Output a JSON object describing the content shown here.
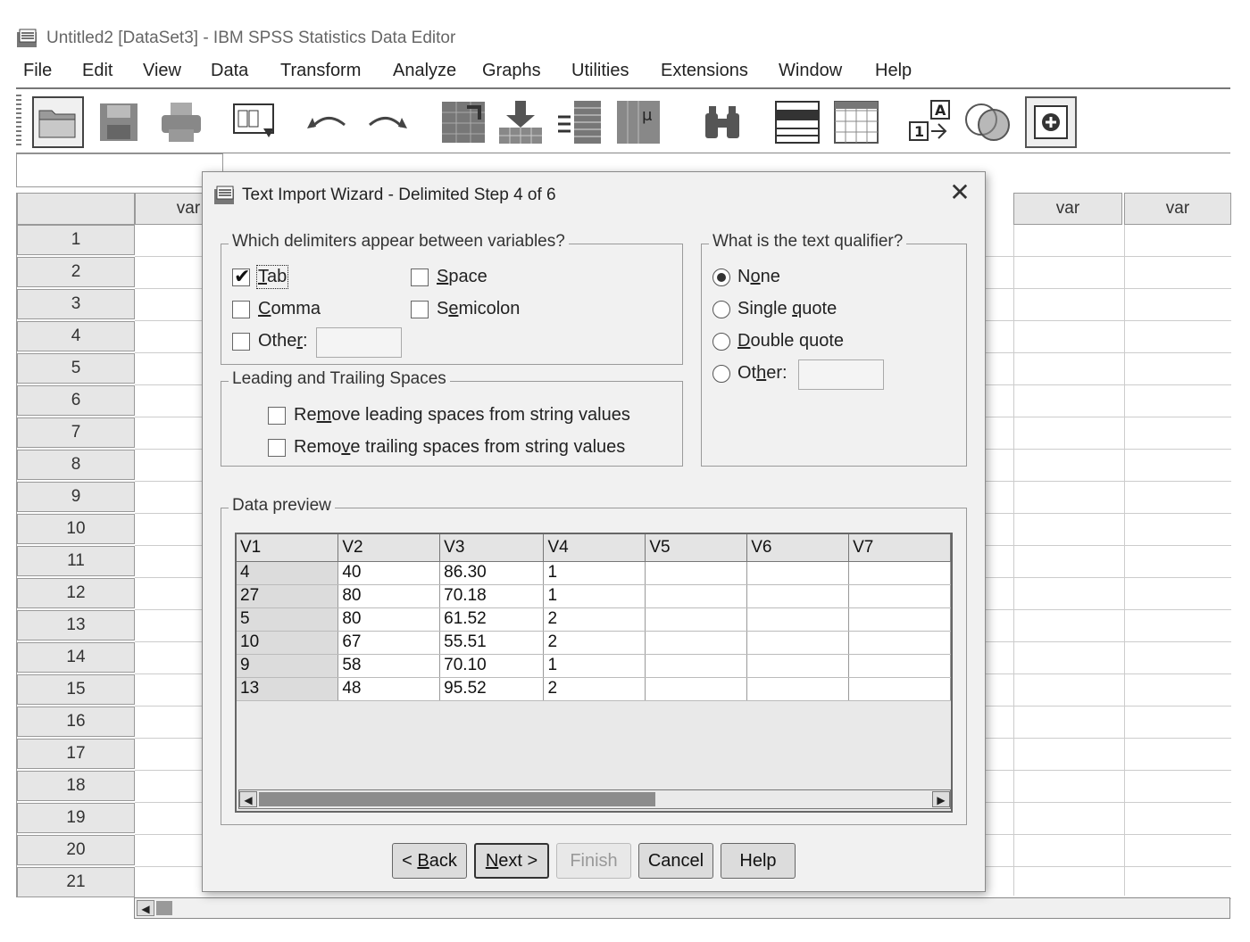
{
  "window": {
    "title": "Untitled2 [DataSet3] - IBM SPSS Statistics Data Editor"
  },
  "menu": [
    "File",
    "Edit",
    "View",
    "Data",
    "Transform",
    "Analyze",
    "Graphs",
    "Utilities",
    "Extensions",
    "Window",
    "Help"
  ],
  "toolbar_icons": [
    "open-folder-icon",
    "save-icon",
    "print-icon",
    "recall-dialog-icon",
    "undo-icon",
    "redo-icon",
    "goto-case-icon",
    "goto-variable-icon",
    "variables-icon",
    "run-descriptive-icon",
    "find-icon",
    "insert-cases-icon",
    "insert-variable-icon",
    "split-file-icon",
    "value-labels-icon",
    "use-sets-icon"
  ],
  "grid": {
    "col_headers": [
      "var",
      "var",
      "var"
    ],
    "rows": [
      "1",
      "2",
      "3",
      "4",
      "5",
      "6",
      "7",
      "8",
      "9",
      "10",
      "11",
      "12",
      "13",
      "14",
      "15",
      "16",
      "17",
      "18",
      "19",
      "20",
      "21"
    ]
  },
  "dialog": {
    "title": "Text Import Wizard - Delimited Step 4 of 6",
    "delimiters_legend": "Which delimiters appear between variables?",
    "delimiters": {
      "tab": "Tab",
      "space": "Space",
      "comma": "Comma",
      "semicolon": "Semicolon",
      "other": "Other:"
    },
    "spaces_legend": "Leading and Trailing Spaces",
    "remove_leading": "Remove leading spaces from string values",
    "remove_trailing": "Remove trailing spaces from string values",
    "qualifier_legend": "What is the text qualifier?",
    "qualifiers": {
      "none": "None",
      "single": "Single quote",
      "double": "Double quote",
      "other": "Other:"
    },
    "preview_legend": "Data preview",
    "preview": {
      "headers": [
        "V1",
        "V2",
        "V3",
        "V4",
        "V5",
        "V6",
        "V7"
      ],
      "rows": [
        [
          "4",
          "40",
          "86.30",
          "1"
        ],
        [
          "27",
          "80",
          "70.18",
          "1"
        ],
        [
          "5",
          "80",
          "61.52",
          "2"
        ],
        [
          "10",
          "67",
          "55.51",
          "2"
        ],
        [
          "9",
          "58",
          "70.10",
          "1"
        ],
        [
          "13",
          "48",
          "95.52",
          "2"
        ]
      ]
    },
    "buttons": {
      "back": "< Back",
      "next": "Next >",
      "finish": "Finish",
      "cancel": "Cancel",
      "help": "Help"
    }
  }
}
